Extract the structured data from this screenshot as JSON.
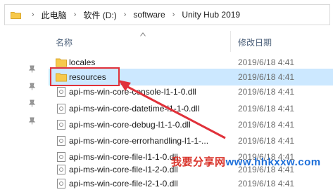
{
  "address_bar": {
    "breadcrumbs": [
      "此电脑",
      "软件 (D:)",
      "software",
      "Unity Hub 2019"
    ]
  },
  "columns": {
    "name": "名称",
    "date_modified": "修改日期"
  },
  "files": [
    {
      "name": "locales",
      "date": "2019/6/18 4:41",
      "type": "folder",
      "selected": false
    },
    {
      "name": "resources",
      "date": "2019/6/18 4:41",
      "type": "folder",
      "selected": true
    },
    {
      "name": "api-ms-win-core-console-l1-1-0.dll",
      "date": "2019/6/18 4:41",
      "type": "dll",
      "selected": false
    },
    {
      "name": "api-ms-win-core-datetime-l1-1-0.dll",
      "date": "2019/6/18 4:41",
      "type": "dll",
      "selected": false
    },
    {
      "name": "api-ms-win-core-debug-l1-1-0.dll",
      "date": "2019/6/18 4:41",
      "type": "dll",
      "selected": false
    },
    {
      "name": "api-ms-win-core-errorhandling-l1-1-...",
      "date": "2019/6/18 4:41",
      "type": "dll",
      "selected": false
    },
    {
      "name": "api-ms-win-core-file-l1-1-0.dll",
      "date": "2019/6/18 4:41",
      "type": "dll",
      "selected": false
    },
    {
      "name": "api-ms-win-core-file-l1-2-0.dll",
      "date": "2019/6/18 4:41",
      "type": "dll",
      "selected": false
    },
    {
      "name": "api-ms-win-core-file-l2-1-0.dll",
      "date": "2019/6/18 4:41",
      "type": "dll",
      "selected": false
    }
  ],
  "watermark": {
    "prefix": "我要分享网",
    "url": "www.hhkxxw.com"
  },
  "colors": {
    "selection": "#cce8ff",
    "highlight_box": "#e0313a",
    "folder": "#f7c94b",
    "header_text": "#4c607a"
  },
  "icons": {
    "address_folder": "folder-icon",
    "pin": "pin-icon",
    "folder": "folder-icon",
    "dll": "dll-file-icon",
    "sort": "sort-arrow-up-icon"
  }
}
